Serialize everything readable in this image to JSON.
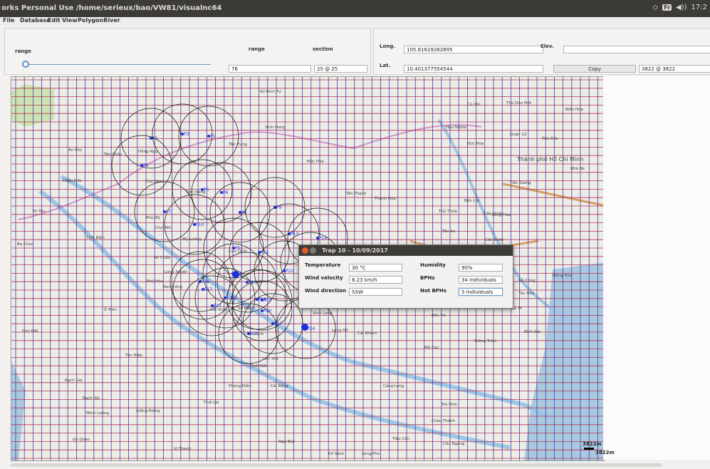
{
  "window": {
    "title": "orks Personal Use /home/serieux/bao/VW81/visualnc64",
    "tray": {
      "keyboard": "Fr",
      "volume": "◀))",
      "clock": "17:2"
    }
  },
  "menu": [
    "File",
    "Database",
    "Edit",
    "View",
    "PolygonRiver"
  ],
  "controls": {
    "range_label": "range",
    "range_header": "range",
    "section_header": "section",
    "range_value": "76",
    "section_value": "25 @ 25",
    "slider_level": 0.02,
    "long_label": "Long.",
    "long_value": "105.81619262695",
    "lat_label": "Lat.",
    "lat_value": "10.401377554544",
    "elev_label": "Elev.",
    "elev_value": "",
    "copy_label": "Copy",
    "copy_value": "3822 @ 3822"
  },
  "map": {
    "places": [
      "Hải Bình Tự",
      "Vĩnh Hưng",
      "Tân Hưng",
      "Mộc Hóa",
      "Châu Đốc",
      "An Phú",
      "Hồng Ngự",
      "Tân Châu",
      "Chợ Vàm",
      "Tam Nông",
      "Phú Mỹ",
      "Chợ Mới",
      "Cao Lãnh",
      "Mỹ Lương",
      "An Châu",
      "Long Xuyên",
      "Phú Hòa",
      "Vàm Cống",
      "Lai Vung",
      "Sa Đéc",
      "Vĩnh Long",
      "Long Hồ",
      "Cái Nhum",
      "Cần Thơ",
      "Tân Định",
      "Thốt Nốt",
      "Phong Điền",
      "Cái Răng",
      "Rạch Giá",
      "Tân Hiệp",
      "Gò Quao",
      "Vị Thanh",
      "Bến Tre",
      "Mỏ Cày",
      "Trà Vinh",
      "Tiểu Cần",
      "Càng Long",
      "Mỹ Tho",
      "Tân An",
      "Thủ Thừa",
      "Bến Lức",
      "Cần Giuộc",
      "Thủ Dầu Một",
      "Biên Hòa",
      "Quận 12",
      "Thủ Đức",
      "Thành phố Hồ Chí Minh",
      "Củ Chi",
      "Long Hòa",
      "Tiền Giang",
      "Đồng Hòa",
      "Chợ Gạo",
      "Gò Công",
      "Tân Hòa",
      "Ba Tri",
      "Bình Đại",
      "Giồng Trôm",
      "Châu Thành",
      "Cầu Ngang",
      "Kế Sách",
      "Long Phú",
      "Ngã Bảy",
      "Minh Lương",
      "Giồng Riềng",
      "Tri Tôn",
      "Ba Chúc",
      "Tịnh Biên",
      "Hòn Đất",
      "Ô Môn",
      "Thới Lai",
      "Nhà Bè",
      "Cần Đước",
      "Đức Hòa",
      "Rạch Sỏi",
      "Tân Thạnh",
      "Thạnh Hóa",
      "Hậu Nghĩa"
    ],
    "traps": [
      {
        "id": "P1"
      },
      {
        "id": "P2"
      },
      {
        "id": "P3"
      },
      {
        "id": "P4"
      },
      {
        "id": "P5"
      },
      {
        "id": "P6"
      },
      {
        "id": "P7"
      },
      {
        "id": "P8"
      },
      {
        "id": "P9"
      },
      {
        "id": "P10"
      },
      {
        "id": "P11"
      },
      {
        "id": "P12"
      },
      {
        "id": "P13"
      },
      {
        "id": "P14"
      },
      {
        "id": "P15"
      },
      {
        "id": "P16"
      },
      {
        "id": "P17"
      },
      {
        "id": "P18"
      },
      {
        "id": "P19"
      },
      {
        "id": "P20"
      },
      {
        "id": "P21"
      },
      {
        "id": "P22"
      },
      {
        "id": "P23"
      },
      {
        "id": "P24"
      },
      {
        "id": "P25"
      },
      {
        "id": "P26"
      },
      {
        "id": "P27"
      },
      {
        "id": "P28"
      }
    ],
    "scale_label": "3822m",
    "scale_label2": "3822m"
  },
  "dialog": {
    "title": "Trap 10 - 10/09/2017",
    "temperature_label": "Temperature",
    "temperature_value": "30 °C",
    "humidity_label": "Humidity",
    "humidity_value": "90%",
    "wind_velocity_label": "Wind velocity",
    "wind_velocity_value": "6.23 km/h",
    "bphs_label": "BPHs",
    "bphs_value": "34 individuals",
    "wind_direction_label": "Wind direction",
    "wind_direction_value": "SSW",
    "not_bphs_label": "Not BPHs",
    "not_bphs_value": "5 individuals"
  },
  "colors": {
    "titlebar": "#3c3b37",
    "grid_horizontal": "#c0304b",
    "grid_vertical": "#3140b8",
    "river": "#9fc6e3",
    "trap_marker": "#1d2fe0",
    "province_border": "#c05ab0"
  }
}
